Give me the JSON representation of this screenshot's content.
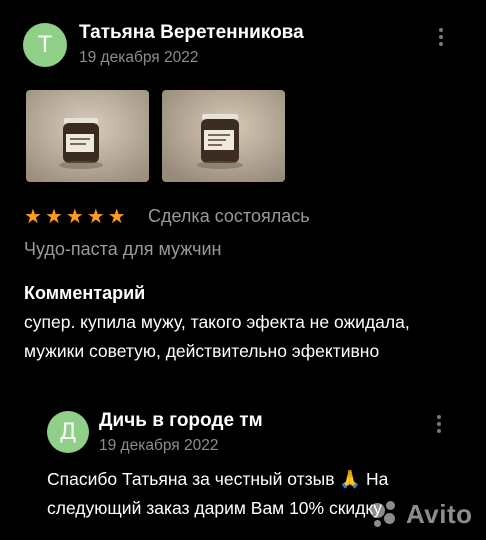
{
  "review": {
    "avatar_letter": "Т",
    "author": "Татьяна Веретенникова",
    "date": "19 декабря 2022",
    "rating": 5,
    "deal_status": "Сделка состоялась",
    "product": "Чудо-паста для мужчин",
    "comment_title": "Комментарий",
    "comment_text": "супер. купила мужу, такого эфекта не ожидала, мужики советую, действительно эфективно"
  },
  "reply": {
    "avatar_letter": "Д",
    "author": "Дичь в городе тм",
    "date": "19 декабря 2022",
    "text": "Спасибо Татьяна за честный отзыв 🙏 На следующий заказ дарим Вам 10% скидку"
  },
  "watermark": {
    "text": "Avito"
  },
  "colors": {
    "background": "#000000",
    "avatar": "#8fcf87",
    "star": "#ff9c1a",
    "secondary_text": "#9a9a9a"
  }
}
